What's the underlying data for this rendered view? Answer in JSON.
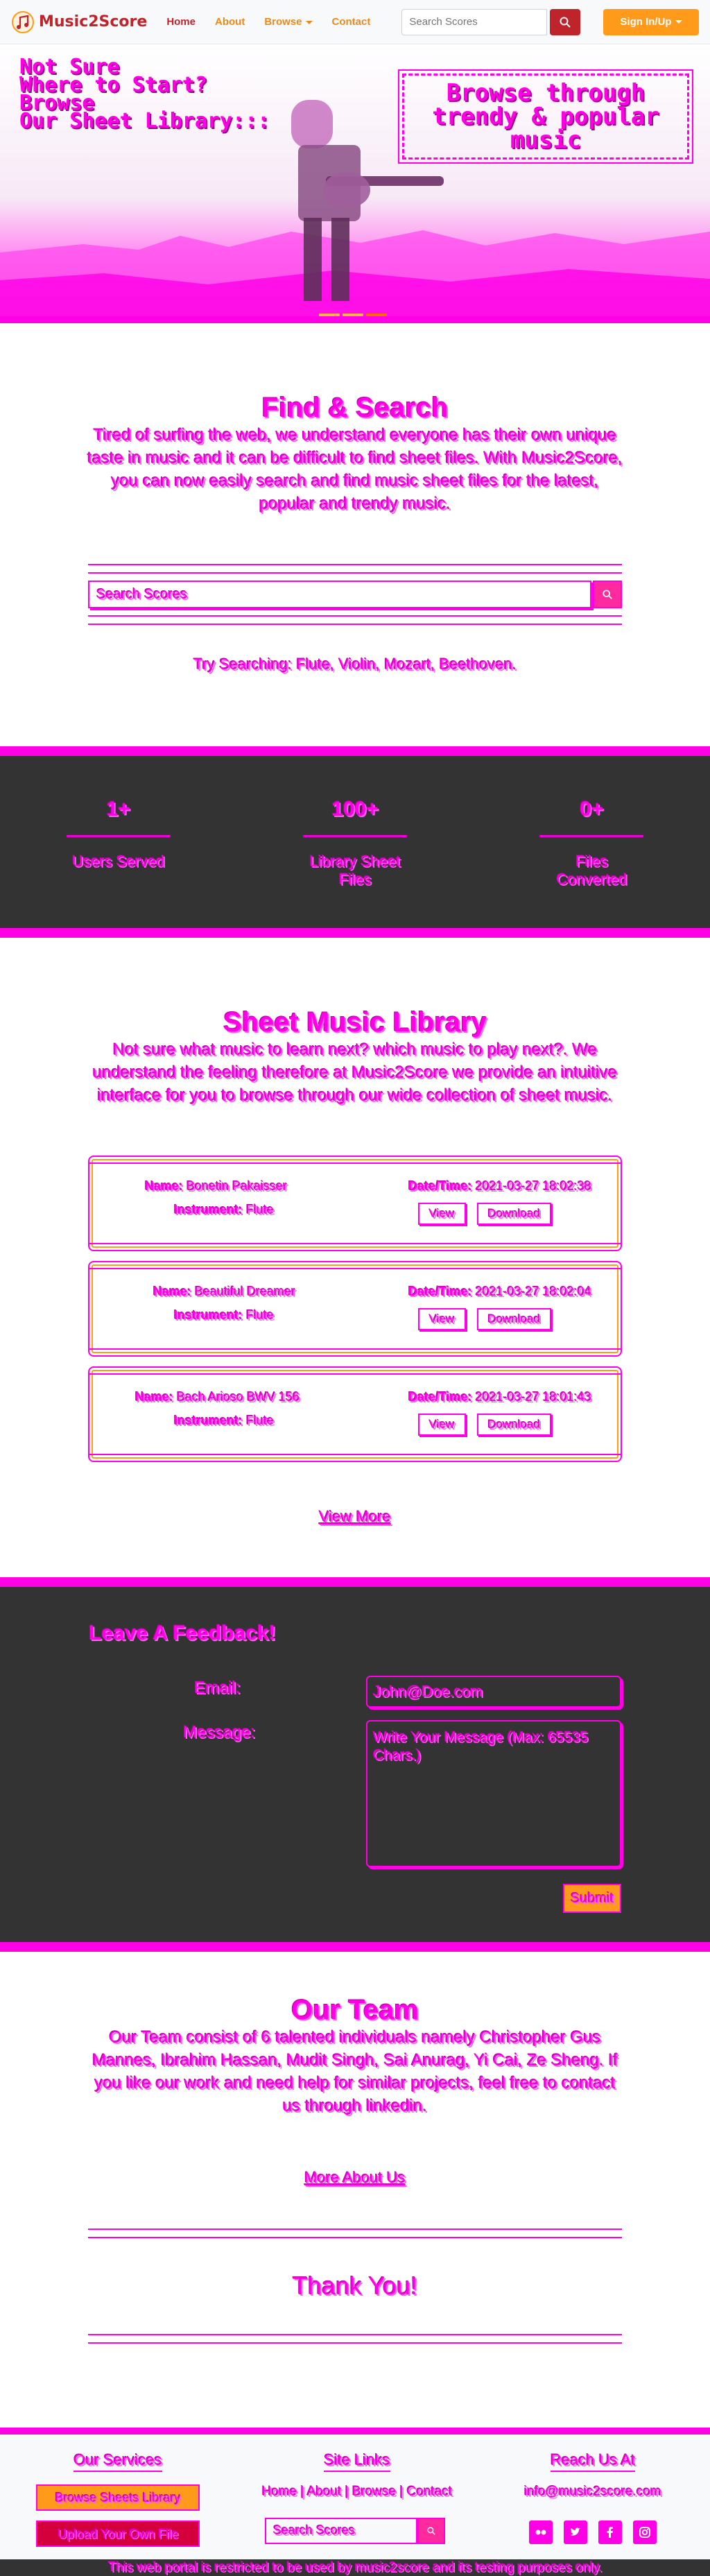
{
  "navbar": {
    "brand": "Music2Score",
    "links": [
      "Home",
      "About",
      "Browse",
      "Contact"
    ],
    "search_placeholder": "Search Scores",
    "signin_label": "Sign In/Up"
  },
  "hero": {
    "left_lines": [
      "Not Sure",
      "Where to Start?",
      "Browse",
      "Our Sheet Library:::"
    ],
    "right_text": "Browse through trendy & popular music"
  },
  "find": {
    "title": "Find & Search",
    "lead": "Tired of surfing the web, we understand everyone has their own unique taste in music and it can be difficult to find sheet files. With Music2Score, you can now easily search and find music sheet files for the latest, popular and trendy music.",
    "search_placeholder": "Search Scores",
    "try_text": "Try Searching: Flute, Violin, Mozart, Beethoven."
  },
  "stats": [
    {
      "value": "1+",
      "label": "Users Served"
    },
    {
      "value": "100+",
      "label": "Library Sheet Files"
    },
    {
      "value": "0+",
      "label": "Files Converted"
    }
  ],
  "library": {
    "title": "Sheet Music Library",
    "lead": "Not sure what music to learn next? which music to play next?. We understand the feeling therefore at Music2Score we provide an intuitive interface for you to browse through our wide collection of sheet music.",
    "name_label": "Name:",
    "instrument_label": "Instrument:",
    "date_label": "Date/Time:",
    "view_label": "View",
    "download_label": "Download",
    "songs": [
      {
        "name": "Bonetin Pakaisser",
        "instrument": "Flute",
        "date": "2021-03-27 18:02:38"
      },
      {
        "name": "Beautiful Dreamer",
        "instrument": "Flute",
        "date": "2021-03-27 18:02:04"
      },
      {
        "name": "Bach Arioso BWV 156",
        "instrument": "Flute",
        "date": "2021-03-27 18:01:43"
      }
    ],
    "view_more": "View More"
  },
  "feedback": {
    "title": "Leave A Feedback!",
    "email_label": "Email:",
    "email_placeholder": "John@Doe.com",
    "message_label": "Message:",
    "message_placeholder": "Write Your Message (Max: 65535 Chars.)",
    "submit_label": "Submit"
  },
  "team": {
    "title": "Our Team",
    "lead": "Our Team consist of 6 talented individuals namely Christopher Gus Mannes, Ibrahim Hassan, Mudit Singh, Sai Anurag, Yi Cai, Ze Sheng. If you like our work and need help for similar projects, feel free to contact us through linkedin.",
    "more_about": "More About Us",
    "thanks": "Thank You!"
  },
  "footer": {
    "services_title": "Our Services",
    "services_btn1": "Browse Sheets Library",
    "services_btn2": "Upload Your Own File",
    "links_title": "Site Links",
    "links_text": "Home | About | Browse | Contact",
    "search_placeholder": "Search Scores",
    "reach_title": "Reach Us At",
    "email": "info@music2score.com",
    "socials": [
      "flickr-icon",
      "twitter-icon",
      "facebook-icon",
      "instagram-icon"
    ],
    "bottom_text": "This web portal is restricted to be used by music2score and its testing purposes only."
  },
  "colors": {
    "accent": "#ff00e6",
    "brand_red": "#c0242b",
    "orange": "#ff9a1a",
    "dark": "#333333"
  }
}
